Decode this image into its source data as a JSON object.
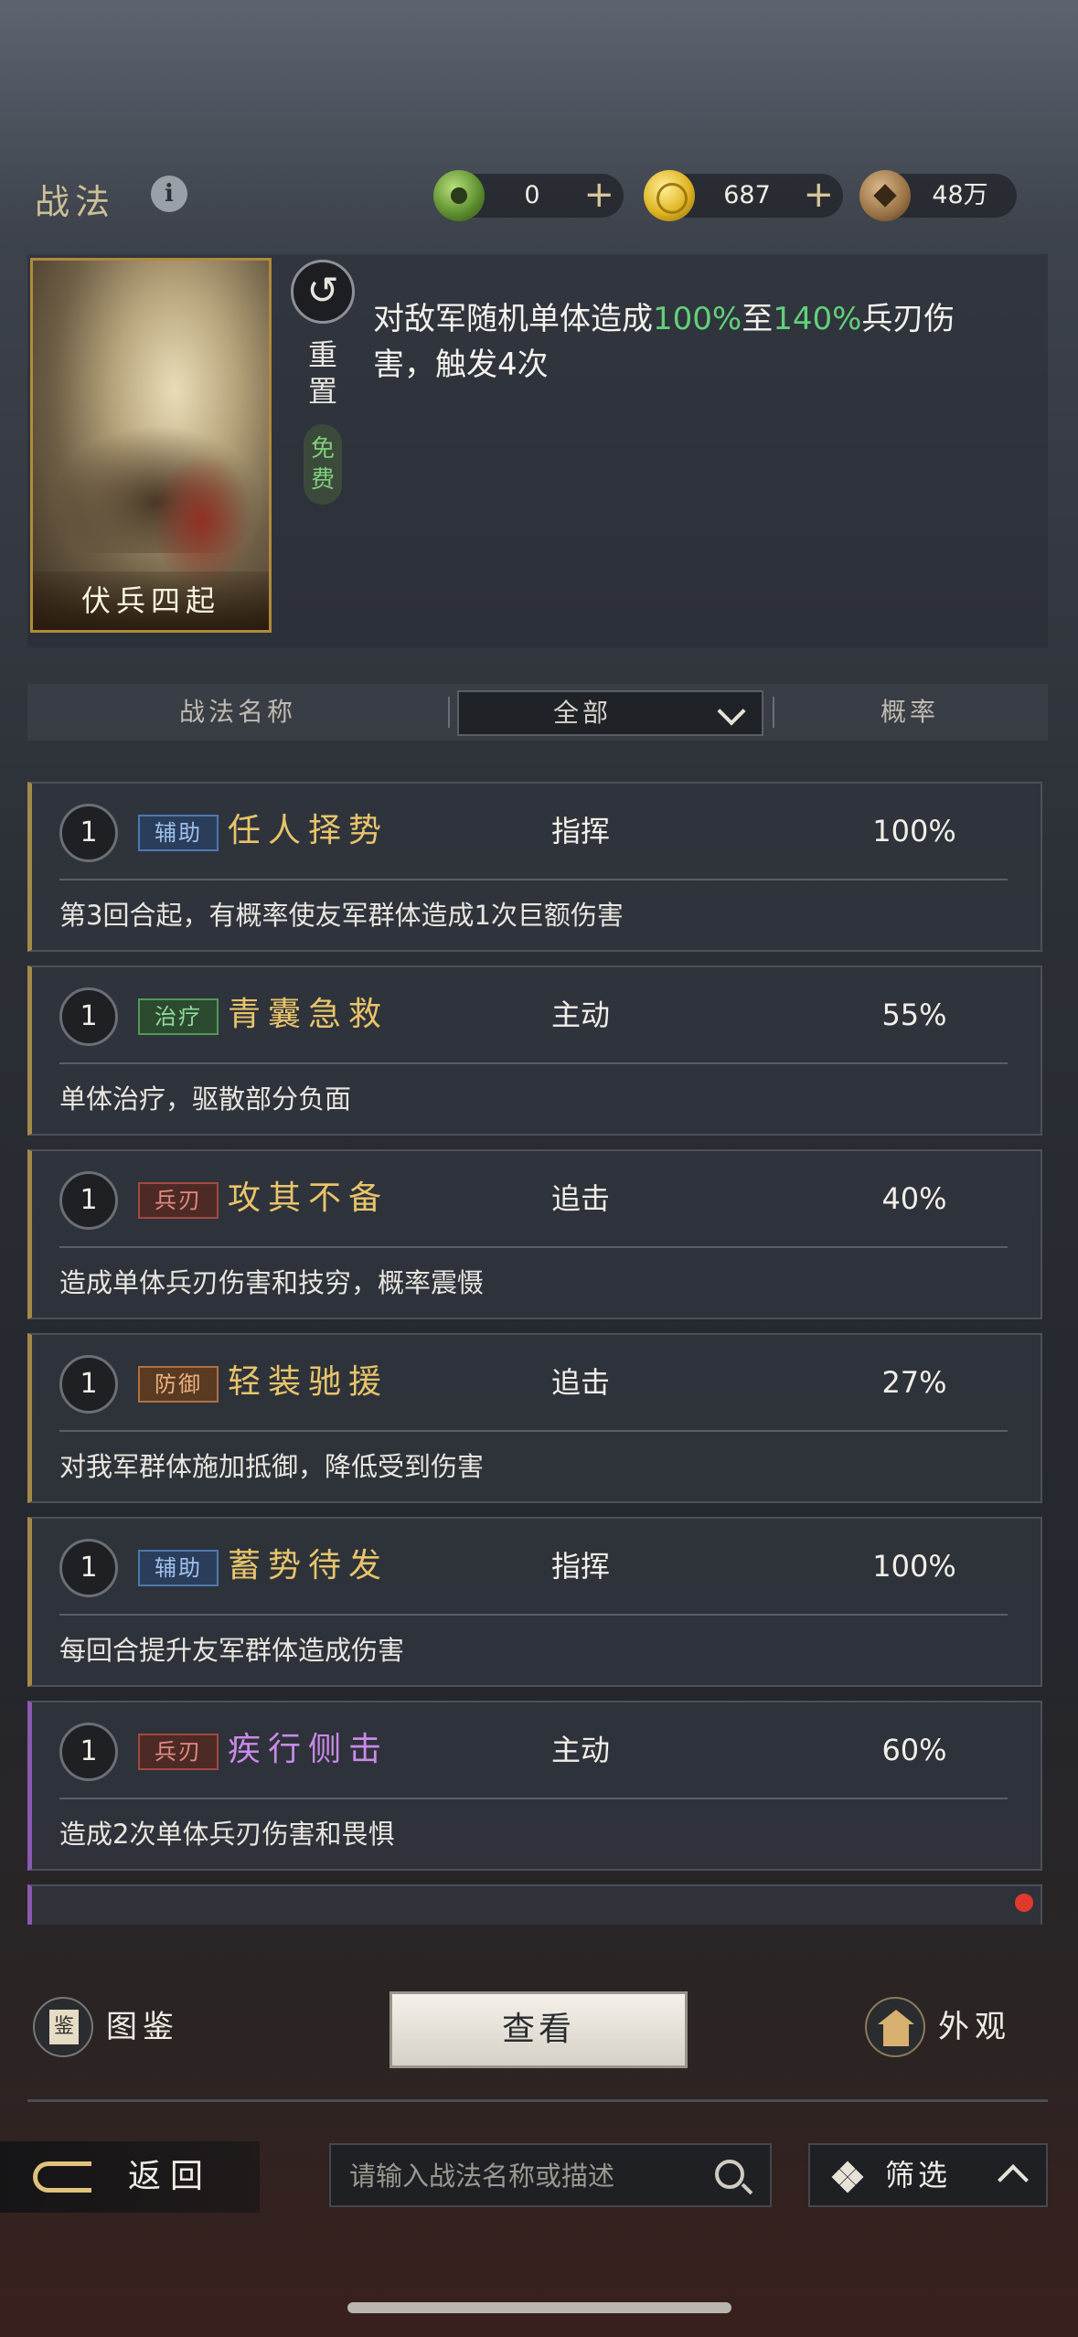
{
  "header": {
    "title": "战法",
    "currencies": [
      {
        "icon": "jade-icon",
        "value": "0"
      },
      {
        "icon": "gold-coin-icon",
        "value": "687"
      },
      {
        "icon": "copper-coin-icon",
        "value": "48万"
      }
    ],
    "plus": "+"
  },
  "selected": {
    "card_name": "伏兵四起",
    "reset_label": "重置",
    "free_label": "免费",
    "desc": {
      "pre": "对敌军随机单体造成",
      "v1": "100%",
      "mid": "至",
      "v2": "140%",
      "post": "兵刃伤害，触发4次"
    }
  },
  "table": {
    "col_name": "战法名称",
    "filter_value": "全部",
    "col_rate": "概率"
  },
  "tactics": [
    {
      "level": "1",
      "tag": "辅助",
      "tag_kind": "aux",
      "name": "任人择势",
      "type": "指挥",
      "rate": "100%",
      "desc": "第3回合起，有概率使友军群体造成1次巨额伤害",
      "quality": "gold"
    },
    {
      "level": "1",
      "tag": "治疗",
      "tag_kind": "heal",
      "name": "青囊急救",
      "type": "主动",
      "rate": "55%",
      "desc": "单体治疗，驱散部分负面",
      "quality": "gold"
    },
    {
      "level": "1",
      "tag": "兵刃",
      "tag_kind": "blade",
      "name": "攻其不备",
      "type": "追击",
      "rate": "40%",
      "desc": "造成单体兵刃伤害和技穷，概率震慑",
      "quality": "gold"
    },
    {
      "level": "1",
      "tag": "防御",
      "tag_kind": "defense",
      "name": "轻装驰援",
      "type": "追击",
      "rate": "27%",
      "desc": "对我军群体施加抵御，降低受到伤害",
      "quality": "gold"
    },
    {
      "level": "1",
      "tag": "辅助",
      "tag_kind": "aux",
      "name": "蓄势待发",
      "type": "指挥",
      "rate": "100%",
      "desc": "每回合提升友军群体造成伤害",
      "quality": "gold"
    },
    {
      "level": "1",
      "tag": "兵刃",
      "tag_kind": "blade",
      "name": "疾行侧击",
      "type": "主动",
      "rate": "60%",
      "desc": "造成2次单体兵刃伤害和畏惧",
      "quality": "purple"
    }
  ],
  "actions": {
    "atlas_label": "图鉴",
    "view_label": "查看",
    "look_label": "外观"
  },
  "nav": {
    "back_label": "返回",
    "search_placeholder": "请输入战法名称或描述",
    "filter_label": "筛选"
  }
}
